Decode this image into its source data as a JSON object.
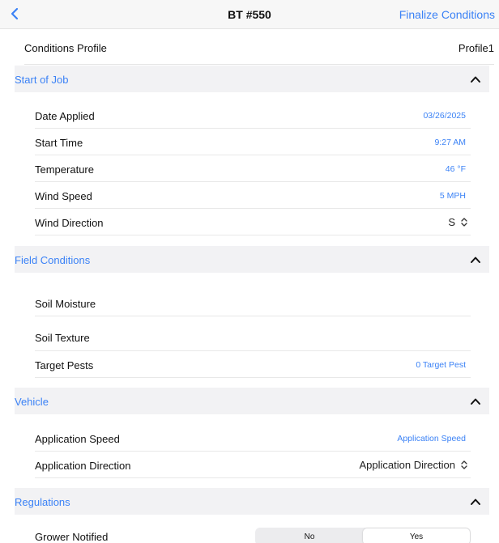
{
  "nav": {
    "title": "BT #550",
    "finalize_label": "Finalize Conditions"
  },
  "profile": {
    "label": "Conditions Profile",
    "value": "Profile1"
  },
  "sections": {
    "start_of_job": {
      "title": "Start of Job",
      "date_applied": {
        "label": "Date Applied",
        "value": "03/26/2025"
      },
      "start_time": {
        "label": "Start Time",
        "value": "9:27 AM"
      },
      "temperature": {
        "label": "Temperature",
        "value": "46 °F"
      },
      "wind_speed": {
        "label": "Wind Speed",
        "value": "5 MPH"
      },
      "wind_direction": {
        "label": "Wind Direction",
        "value": "S"
      }
    },
    "field_conditions": {
      "title": "Field Conditions",
      "soil_moisture": {
        "label": "Soil Moisture"
      },
      "soil_texture": {
        "label": "Soil Texture"
      },
      "target_pests": {
        "label": "Target Pests",
        "value": "0 Target Pest"
      }
    },
    "vehicle": {
      "title": "Vehicle",
      "application_speed": {
        "label": "Application Speed",
        "placeholder": "Application Speed"
      },
      "application_direction": {
        "label": "Application Direction",
        "value": "Application Direction"
      }
    },
    "regulations": {
      "title": "Regulations",
      "grower_notified": {
        "label": "Grower Notified",
        "options": [
          "No",
          "Yes"
        ],
        "selected": "Yes"
      }
    }
  },
  "colors": {
    "accent": "#3b82f6",
    "section_bg": "#f2f2f4"
  },
  "icons": {
    "back": "chevron-left-icon",
    "collapse": "chevron-up-icon",
    "picker": "up-down-chevron-icon"
  }
}
